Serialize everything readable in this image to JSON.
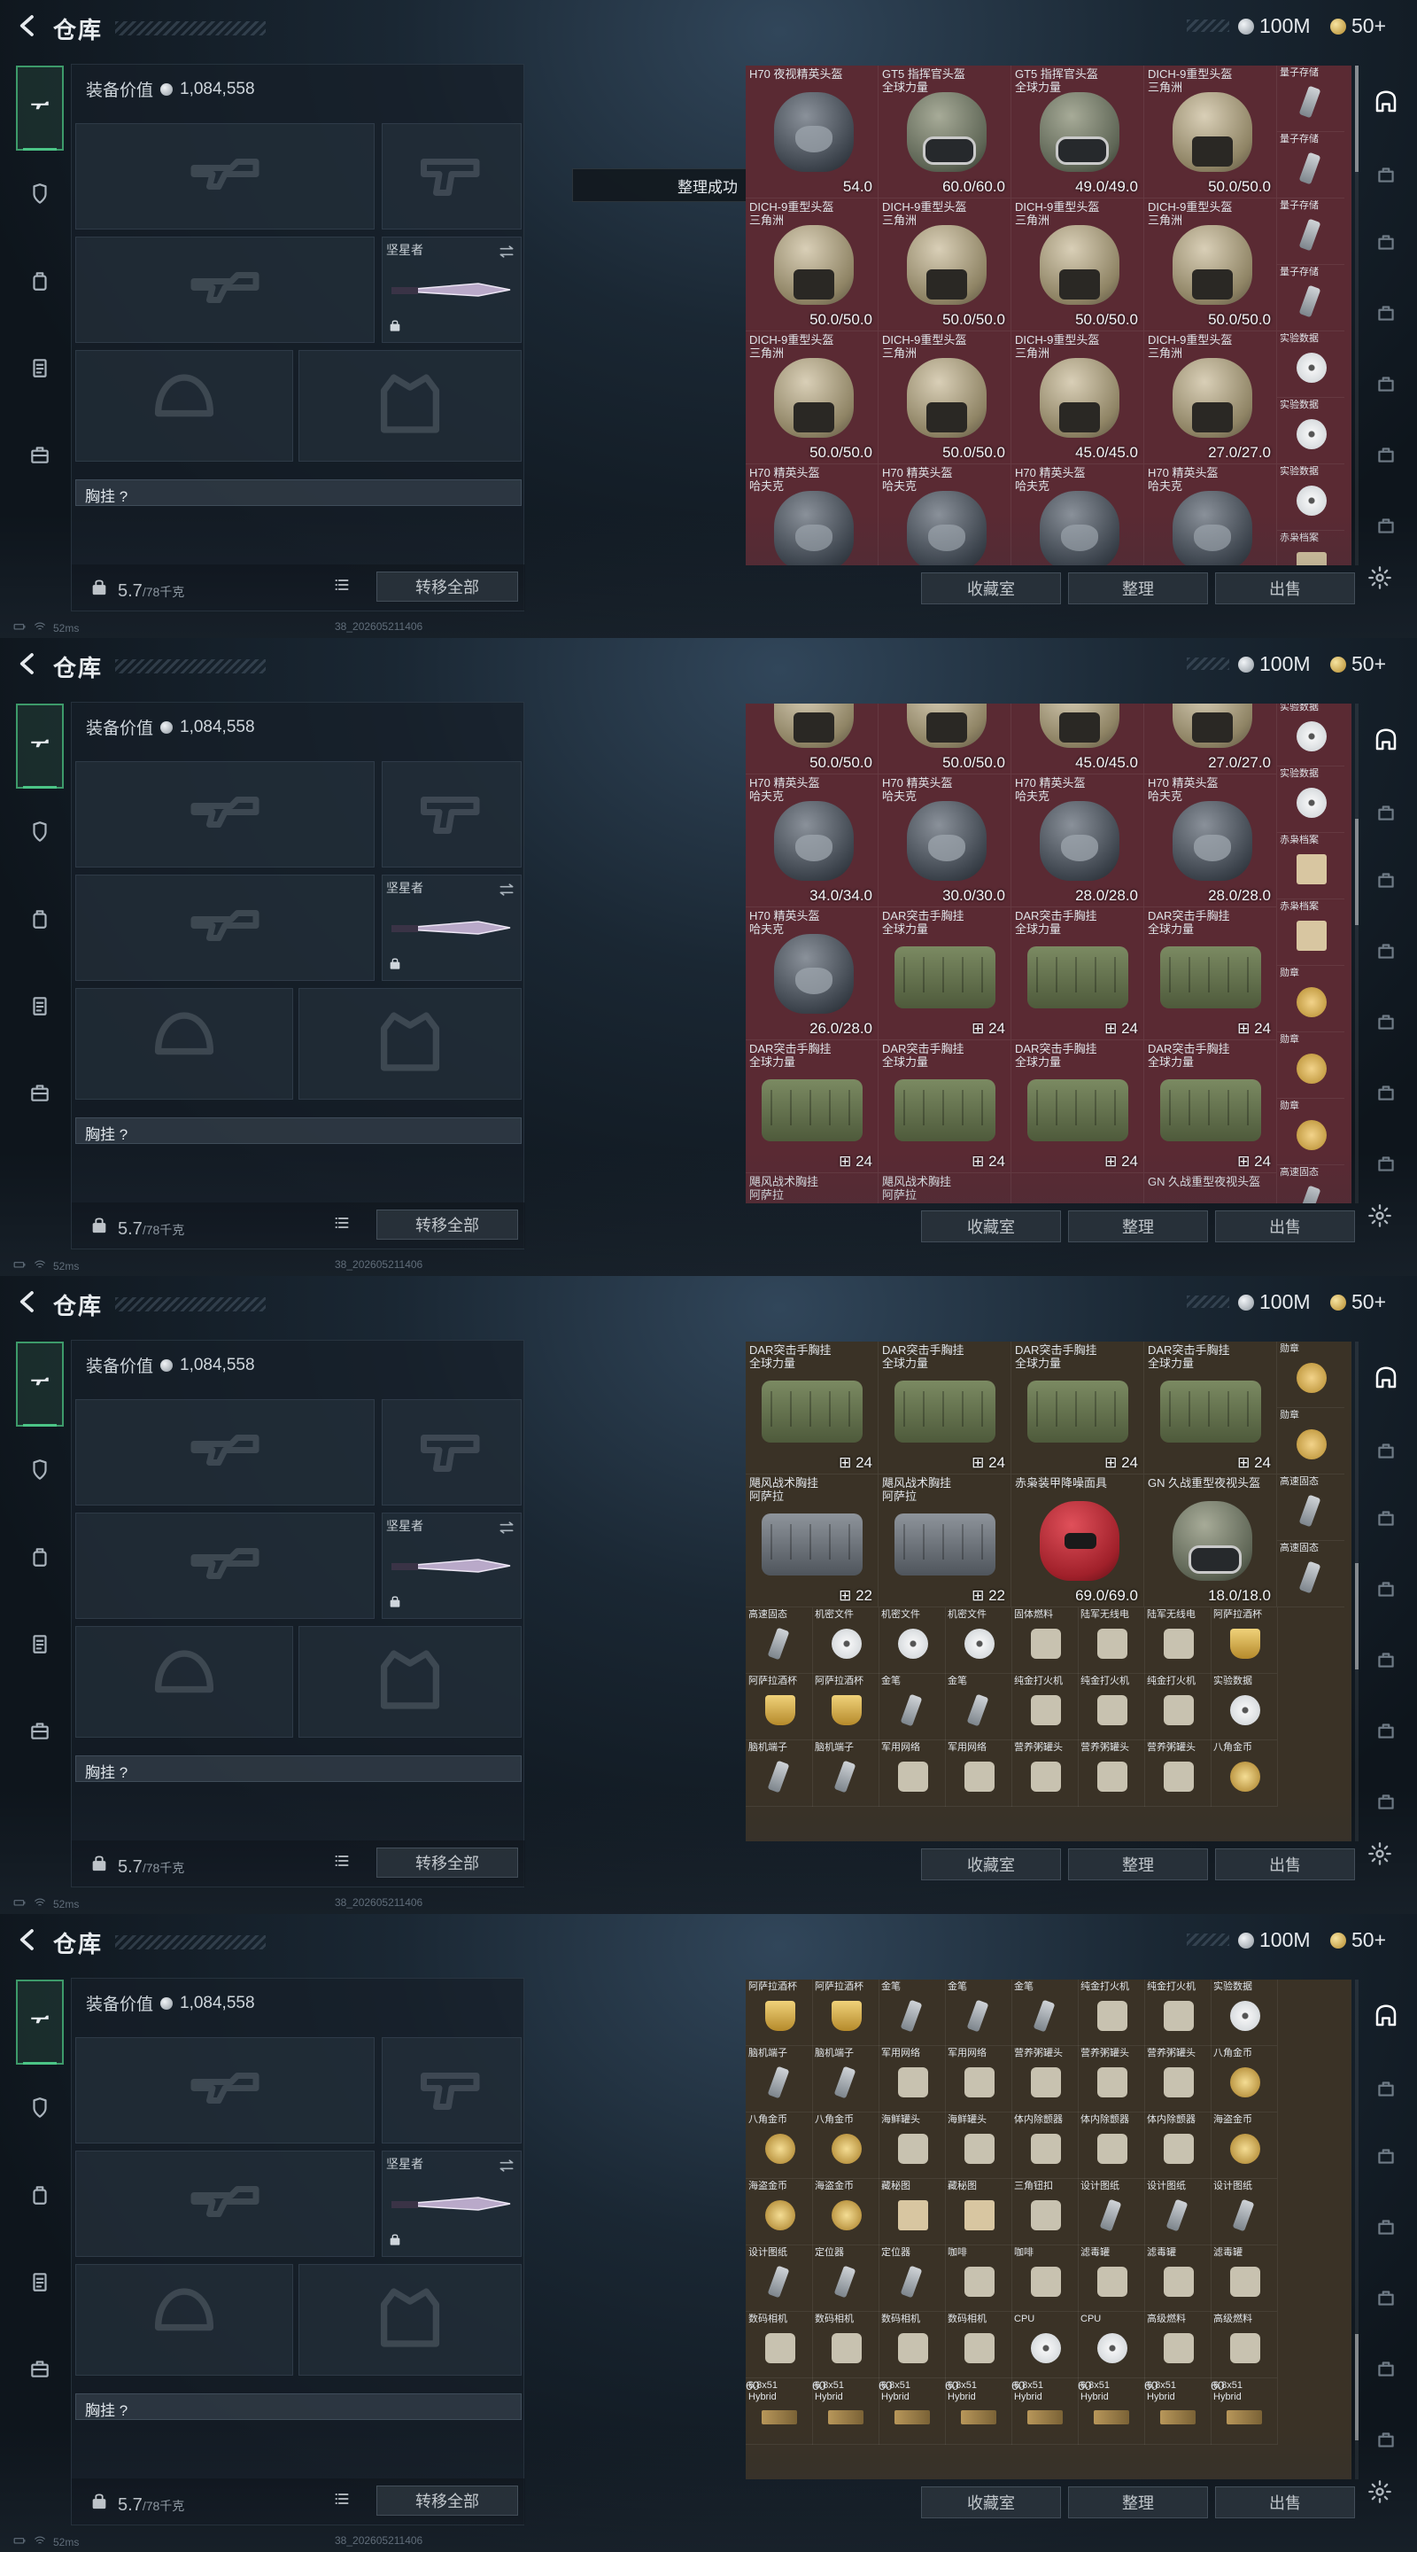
{
  "header": {
    "title": "仓库",
    "money": "100M",
    "tickets": "50+"
  },
  "equipment": {
    "value_label": "装备价值",
    "value": "1,084,558",
    "melee_label": "坚星者",
    "chest_label": "胸挂 ?",
    "weight": "5.7",
    "weight_max": "/78千克",
    "transfer_label": "转移全部"
  },
  "status": {
    "ping": "52ms",
    "build": "38_202605211406"
  },
  "toast": "整理成功",
  "actions": {
    "collect": "收藏室",
    "sort": "整理",
    "sell": "出售"
  },
  "frames": [
    {
      "big": [
        {
          "name": "H70 夜视精英头盔",
          "dur": "54.0",
          "icon": "dark"
        },
        {
          "name": "GT5 指挥官头盔\n全球力量",
          "dur": "60.0/60.0",
          "icon": "camo"
        },
        {
          "name": "GT5 指挥官头盔\n全球力量",
          "dur": "49.0/49.0",
          "icon": "camo"
        },
        {
          "name": "DICH-9重型头盔\n三角洲",
          "dur": "50.0/50.0",
          "icon": "tan"
        },
        {
          "name": "DICH-9重型头盔\n三角洲",
          "dur": "50.0/50.0",
          "icon": "tan"
        },
        {
          "name": "DICH-9重型头盔\n三角洲",
          "dur": "50.0/50.0",
          "icon": "tan"
        },
        {
          "name": "DICH-9重型头盔\n三角洲",
          "dur": "50.0/50.0",
          "icon": "tan"
        },
        {
          "name": "DICH-9重型头盔\n三角洲",
          "dur": "50.0/50.0",
          "icon": "tan"
        },
        {
          "name": "DICH-9重型头盔\n三角洲",
          "dur": "50.0/50.0",
          "icon": "tan"
        },
        {
          "name": "DICH-9重型头盔\n三角洲",
          "dur": "50.0/50.0",
          "icon": "tan"
        },
        {
          "name": "DICH-9重型头盔\n三角洲",
          "dur": "45.0/45.0",
          "icon": "tan"
        },
        {
          "name": "DICH-9重型头盔\n三角洲",
          "dur": "27.0/27.0",
          "icon": "tan"
        },
        {
          "name": "H70 精英头盔\n哈夫克",
          "dur": "",
          "icon": "dark"
        },
        {
          "name": "H70 精英头盔\n哈夫克",
          "dur": "",
          "icon": "dark"
        },
        {
          "name": "H70 精英头盔\n哈夫克",
          "dur": "",
          "icon": "dark"
        },
        {
          "name": "H70 精英头盔\n哈夫克",
          "dur": "",
          "icon": "dark"
        }
      ],
      "side": [
        {
          "name": "量子存储",
          "icon": "usb"
        },
        {
          "name": "量子存储",
          "icon": "usb"
        },
        {
          "name": "量子存储",
          "icon": "usb"
        },
        {
          "name": "量子存储",
          "icon": "usb"
        },
        {
          "name": "实验数据",
          "icon": "disc"
        },
        {
          "name": "实验数据",
          "icon": "disc"
        },
        {
          "name": "实验数据",
          "icon": "disc"
        },
        {
          "name": "赤枭档案",
          "icon": "doc"
        }
      ]
    },
    {
      "big": [
        {
          "name": "",
          "dur": "50.0/50.0",
          "icon": "tan"
        },
        {
          "name": "",
          "dur": "50.0/50.0",
          "icon": "tan"
        },
        {
          "name": "",
          "dur": "45.0/45.0",
          "icon": "tan"
        },
        {
          "name": "",
          "dur": "27.0/27.0",
          "icon": "tan"
        },
        {
          "name": "H70 精英头盔\n哈夫克",
          "dur": "34.0/34.0",
          "icon": "dark"
        },
        {
          "name": "H70 精英头盔\n哈夫克",
          "dur": "30.0/30.0",
          "icon": "dark"
        },
        {
          "name": "H70 精英头盔\n哈夫克",
          "dur": "28.0/28.0",
          "icon": "dark"
        },
        {
          "name": "H70 精英头盔\n哈夫克",
          "dur": "28.0/28.0",
          "icon": "dark"
        },
        {
          "name": "H70 精英头盔\n哈夫克",
          "dur": "26.0/28.0",
          "icon": "dark"
        },
        {
          "name": "DAR突击手胸挂\n全球力量",
          "cnt": "24",
          "icon": "rig-green"
        },
        {
          "name": "DAR突击手胸挂\n全球力量",
          "cnt": "24",
          "icon": "rig-green"
        },
        {
          "name": "DAR突击手胸挂\n全球力量",
          "cnt": "24",
          "icon": "rig-green"
        },
        {
          "name": "DAR突击手胸挂\n全球力量",
          "cnt": "24",
          "icon": "rig-green"
        },
        {
          "name": "DAR突击手胸挂\n全球力量",
          "cnt": "24",
          "icon": "rig-green"
        },
        {
          "name": "DAR突击手胸挂\n全球力量",
          "cnt": "24",
          "icon": "rig-green"
        },
        {
          "name": "DAR突击手胸挂\n全球力量",
          "cnt": "24",
          "icon": "rig-green"
        },
        {
          "name": "飓风战术胸挂\n阿萨拉",
          "dur": "",
          "icon": "none"
        },
        {
          "name": "飓风战术胸挂\n阿萨拉",
          "dur": "",
          "icon": "none"
        },
        {
          "name": "",
          "dur": "",
          "icon": "none"
        },
        {
          "name": "GN 久战重型夜视头盔",
          "dur": "",
          "icon": "none"
        }
      ],
      "side": [
        {
          "name": "实验数据",
          "icon": "disc"
        },
        {
          "name": "实验数据",
          "icon": "disc"
        },
        {
          "name": "赤枭档案",
          "icon": "doc"
        },
        {
          "name": "赤枭档案",
          "icon": "doc"
        },
        {
          "name": "勋章",
          "icon": "medal"
        },
        {
          "name": "勋章",
          "icon": "medal"
        },
        {
          "name": "勋章",
          "icon": "medal"
        },
        {
          "name": "高速固态",
          "icon": "usb"
        }
      ]
    },
    {
      "big": [
        {
          "name": "DAR突击手胸挂\n全球力量",
          "cnt": "24",
          "icon": "rig-green"
        },
        {
          "name": "DAR突击手胸挂\n全球力量",
          "cnt": "24",
          "icon": "rig-green"
        },
        {
          "name": "DAR突击手胸挂\n全球力量",
          "cnt": "24",
          "icon": "rig-green"
        },
        {
          "name": "DAR突击手胸挂\n全球力量",
          "cnt": "24",
          "icon": "rig-green"
        },
        {
          "name": "飓风战术胸挂\n阿萨拉",
          "cnt": "22",
          "icon": "rig-grey"
        },
        {
          "name": "飓风战术胸挂\n阿萨拉",
          "cnt": "22",
          "icon": "rig-grey"
        },
        {
          "name": "赤枭装甲降噪面具",
          "dur": "69.0/69.0",
          "icon": "red"
        },
        {
          "name": "GN 久战重型夜视头盔",
          "dur": "18.0/18.0",
          "icon": "camo"
        }
      ],
      "side": [
        {
          "name": "勋章",
          "icon": "medal"
        },
        {
          "name": "勋章",
          "icon": "medal"
        },
        {
          "name": "高速固态",
          "icon": "usb"
        },
        {
          "name": "高速固态",
          "icon": "usb"
        }
      ],
      "small": [
        {
          "name": "高速固态",
          "icon": "usb"
        },
        {
          "name": "机密文件",
          "icon": "disc"
        },
        {
          "name": "机密文件",
          "icon": "disc"
        },
        {
          "name": "机密文件",
          "icon": "disc"
        },
        {
          "name": "固体燃料",
          "icon": "bag"
        },
        {
          "name": "陆军无线电",
          "icon": "bag"
        },
        {
          "name": "陆军无线电",
          "icon": "bag"
        },
        {
          "name": "阿萨拉酒杯",
          "icon": "cup"
        },
        {
          "name": "阿萨拉酒杯",
          "icon": "cup"
        },
        {
          "name": "阿萨拉酒杯",
          "icon": "cup"
        },
        {
          "name": "金笔",
          "icon": "usb"
        },
        {
          "name": "金笔",
          "icon": "usb"
        },
        {
          "name": "纯金打火机",
          "icon": "bag"
        },
        {
          "name": "纯金打火机",
          "icon": "bag"
        },
        {
          "name": "纯金打火机",
          "icon": "bag"
        },
        {
          "name": "实验数据",
          "icon": "disc"
        },
        {
          "name": "脑机端子",
          "icon": "usb"
        },
        {
          "name": "脑机端子",
          "icon": "usb"
        },
        {
          "name": "军用网络",
          "icon": "bag"
        },
        {
          "name": "军用网络",
          "icon": "bag"
        },
        {
          "name": "营养粥罐头",
          "icon": "bag"
        },
        {
          "name": "营养粥罐头",
          "icon": "bag"
        },
        {
          "name": "营养粥罐头",
          "icon": "bag"
        },
        {
          "name": "八角金币",
          "icon": "coin"
        }
      ]
    },
    {
      "small": [
        {
          "name": "阿萨拉酒杯",
          "icon": "cup"
        },
        {
          "name": "阿萨拉酒杯",
          "icon": "cup"
        },
        {
          "name": "金笔",
          "icon": "usb"
        },
        {
          "name": "金笔",
          "icon": "usb"
        },
        {
          "name": "金笔",
          "icon": "usb"
        },
        {
          "name": "纯金打火机",
          "icon": "bag"
        },
        {
          "name": "纯金打火机",
          "icon": "bag"
        },
        {
          "name": "实验数据",
          "icon": "disc"
        },
        {
          "name": "脑机端子",
          "icon": "usb"
        },
        {
          "name": "脑机端子",
          "icon": "usb"
        },
        {
          "name": "军用网络",
          "icon": "bag"
        },
        {
          "name": "军用网络",
          "icon": "bag"
        },
        {
          "name": "营养粥罐头",
          "icon": "bag"
        },
        {
          "name": "营养粥罐头",
          "icon": "bag"
        },
        {
          "name": "营养粥罐头",
          "icon": "bag"
        },
        {
          "name": "八角金币",
          "icon": "coin"
        },
        {
          "name": "八角金币",
          "icon": "coin"
        },
        {
          "name": "八角金币",
          "icon": "coin"
        },
        {
          "name": "海鲜罐头",
          "icon": "bag"
        },
        {
          "name": "海鲜罐头",
          "icon": "bag"
        },
        {
          "name": "体内除颤器",
          "icon": "bag"
        },
        {
          "name": "体内除颤器",
          "icon": "bag"
        },
        {
          "name": "体内除颤器",
          "icon": "bag"
        },
        {
          "name": "海盗金币",
          "icon": "coin"
        },
        {
          "name": "海盗金币",
          "icon": "coin"
        },
        {
          "name": "海盗金币",
          "icon": "coin"
        },
        {
          "name": "藏秘图",
          "icon": "doc"
        },
        {
          "name": "藏秘图",
          "icon": "doc"
        },
        {
          "name": "三角钮扣",
          "icon": "bag"
        },
        {
          "name": "设计图纸",
          "icon": "usb"
        },
        {
          "name": "设计图纸",
          "icon": "usb"
        },
        {
          "name": "设计图纸",
          "icon": "usb"
        },
        {
          "name": "设计图纸",
          "icon": "usb"
        },
        {
          "name": "定位器",
          "icon": "usb"
        },
        {
          "name": "定位器",
          "icon": "usb"
        },
        {
          "name": "咖啡",
          "icon": "bag"
        },
        {
          "name": "咖啡",
          "icon": "bag"
        },
        {
          "name": "滤毒罐",
          "icon": "bag"
        },
        {
          "name": "滤毒罐",
          "icon": "bag"
        },
        {
          "name": "滤毒罐",
          "icon": "bag"
        },
        {
          "name": "数码相机",
          "icon": "bag"
        },
        {
          "name": "数码相机",
          "icon": "bag"
        },
        {
          "name": "数码相机",
          "icon": "bag"
        },
        {
          "name": "数码相机",
          "icon": "bag"
        },
        {
          "name": "CPU",
          "icon": "disc"
        },
        {
          "name": "CPU",
          "icon": "disc"
        },
        {
          "name": "高级燃料",
          "icon": "bag"
        },
        {
          "name": "高级燃料",
          "icon": "bag"
        }
      ],
      "ammo": [
        {
          "name": "6.8x51\nHybrid",
          "cnt": "60"
        },
        {
          "name": "6.8x51\nHybrid",
          "cnt": "60"
        },
        {
          "name": "6.8x51\nHybrid",
          "cnt": "60"
        },
        {
          "name": "6.8x51\nHybrid",
          "cnt": "60"
        },
        {
          "name": "6.8x51\nHybrid",
          "cnt": "60"
        },
        {
          "name": "6.8x51\nHybrid",
          "cnt": "60"
        },
        {
          "name": "6.8x51\nHybrid",
          "cnt": "60"
        },
        {
          "name": "6.8x51\nHybrid",
          "cnt": "60"
        }
      ]
    }
  ],
  "colors": {
    "stash_red": "#5a2a33",
    "stash_brown": "#3a3226",
    "accent_green": "#4bc486"
  }
}
